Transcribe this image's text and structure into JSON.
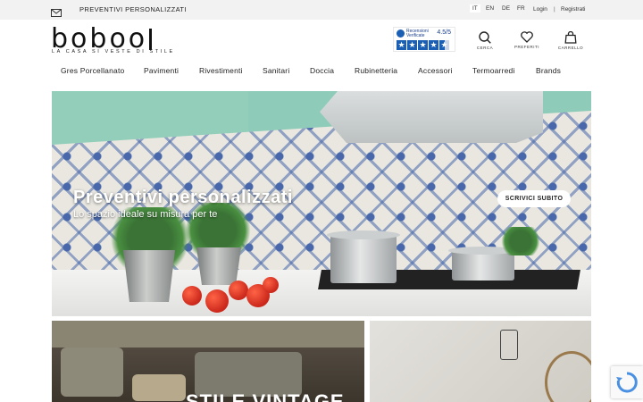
{
  "topbar": {
    "promo": "PREVENTIVI PERSONALIZZATI",
    "languages": [
      "IT",
      "EN",
      "DE",
      "FR"
    ],
    "active_language": "IT",
    "login": "Login",
    "separator": "|",
    "register": "Registrati"
  },
  "header": {
    "logo": "boboo",
    "tagline": "LA CASA SI VESTE DI STILE",
    "trust": {
      "label_line1": "Recensioni",
      "label_line2": "Verificate",
      "score": "4.5/5"
    },
    "icons": {
      "search": "CERCA",
      "favorites": "PREFERITI",
      "cart": "CARRELLO"
    }
  },
  "nav": {
    "items": [
      "Gres Porcellanato",
      "Pavimenti",
      "Rivestimenti",
      "Sanitari",
      "Doccia",
      "Rubinetteria",
      "Accessori",
      "Termoarredi",
      "Brands"
    ]
  },
  "hero": {
    "title": "Preventivi personalizzati",
    "subtitle": "Lo spazio ideale su misura per te",
    "cta": "SCRIVICI SUBITO"
  },
  "cards": {
    "left_title": "STILE VINTAGE"
  },
  "colors": {
    "topbar_bg": "#f2f2f2",
    "brand_text": "#111111",
    "trust_blue": "#1a5fb4"
  }
}
